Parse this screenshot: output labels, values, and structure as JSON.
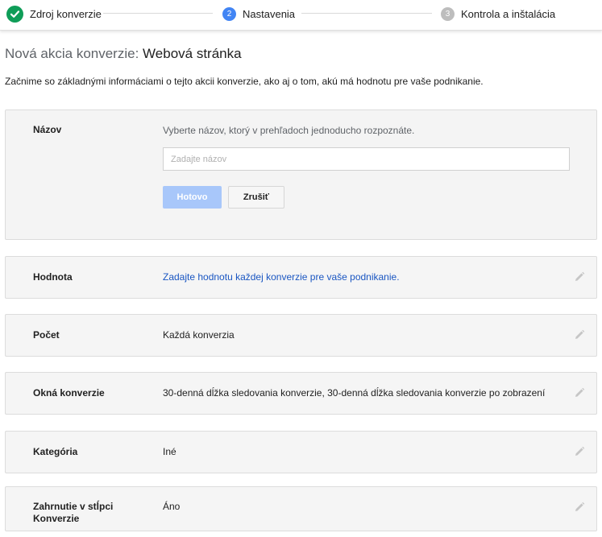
{
  "stepper": {
    "steps": [
      {
        "label": "Zdroj konverzie",
        "state": "done"
      },
      {
        "number": "2",
        "label": "Nastavenia",
        "state": "active"
      },
      {
        "number": "3",
        "label": "Kontrola a inštalácia",
        "state": "pending"
      }
    ]
  },
  "header": {
    "title_prefix": "Nová akcia konverzie:",
    "title_type": "Webová stránka",
    "description": "Začnime so základnými informáciami o tejto akcii konverzie, ako aj o tom, akú má hodnotu pre vaše podnikanie."
  },
  "name_section": {
    "label": "Názov",
    "hint": "Vyberte názov, ktorý v prehľadoch jednoducho rozpoznáte.",
    "input_value": "",
    "input_placeholder": "Zadajte názov",
    "done_label": "Hotovo",
    "cancel_label": "Zrušiť"
  },
  "sections": [
    {
      "label": "Hodnota",
      "value": "Zadajte hodnotu každej konverzie pre vaše podnikanie."
    },
    {
      "label": "Počet",
      "value": "Každá konverzia"
    },
    {
      "label": "Okná konverzie",
      "value": "30-denná dĺžka sledovania konverzie, 30-denná dĺžka sledovania konverzie po zobrazení"
    },
    {
      "label": "Kategória",
      "value": "Iné"
    },
    {
      "label": "Zahrnutie v stĺpci Konverzie",
      "value": "Áno"
    }
  ],
  "colors": {
    "done_green": "#0f9d58",
    "active_blue": "#4285f4",
    "link_blue": "#1a56c2",
    "primary_button_disabled": "#a8c7fa"
  }
}
